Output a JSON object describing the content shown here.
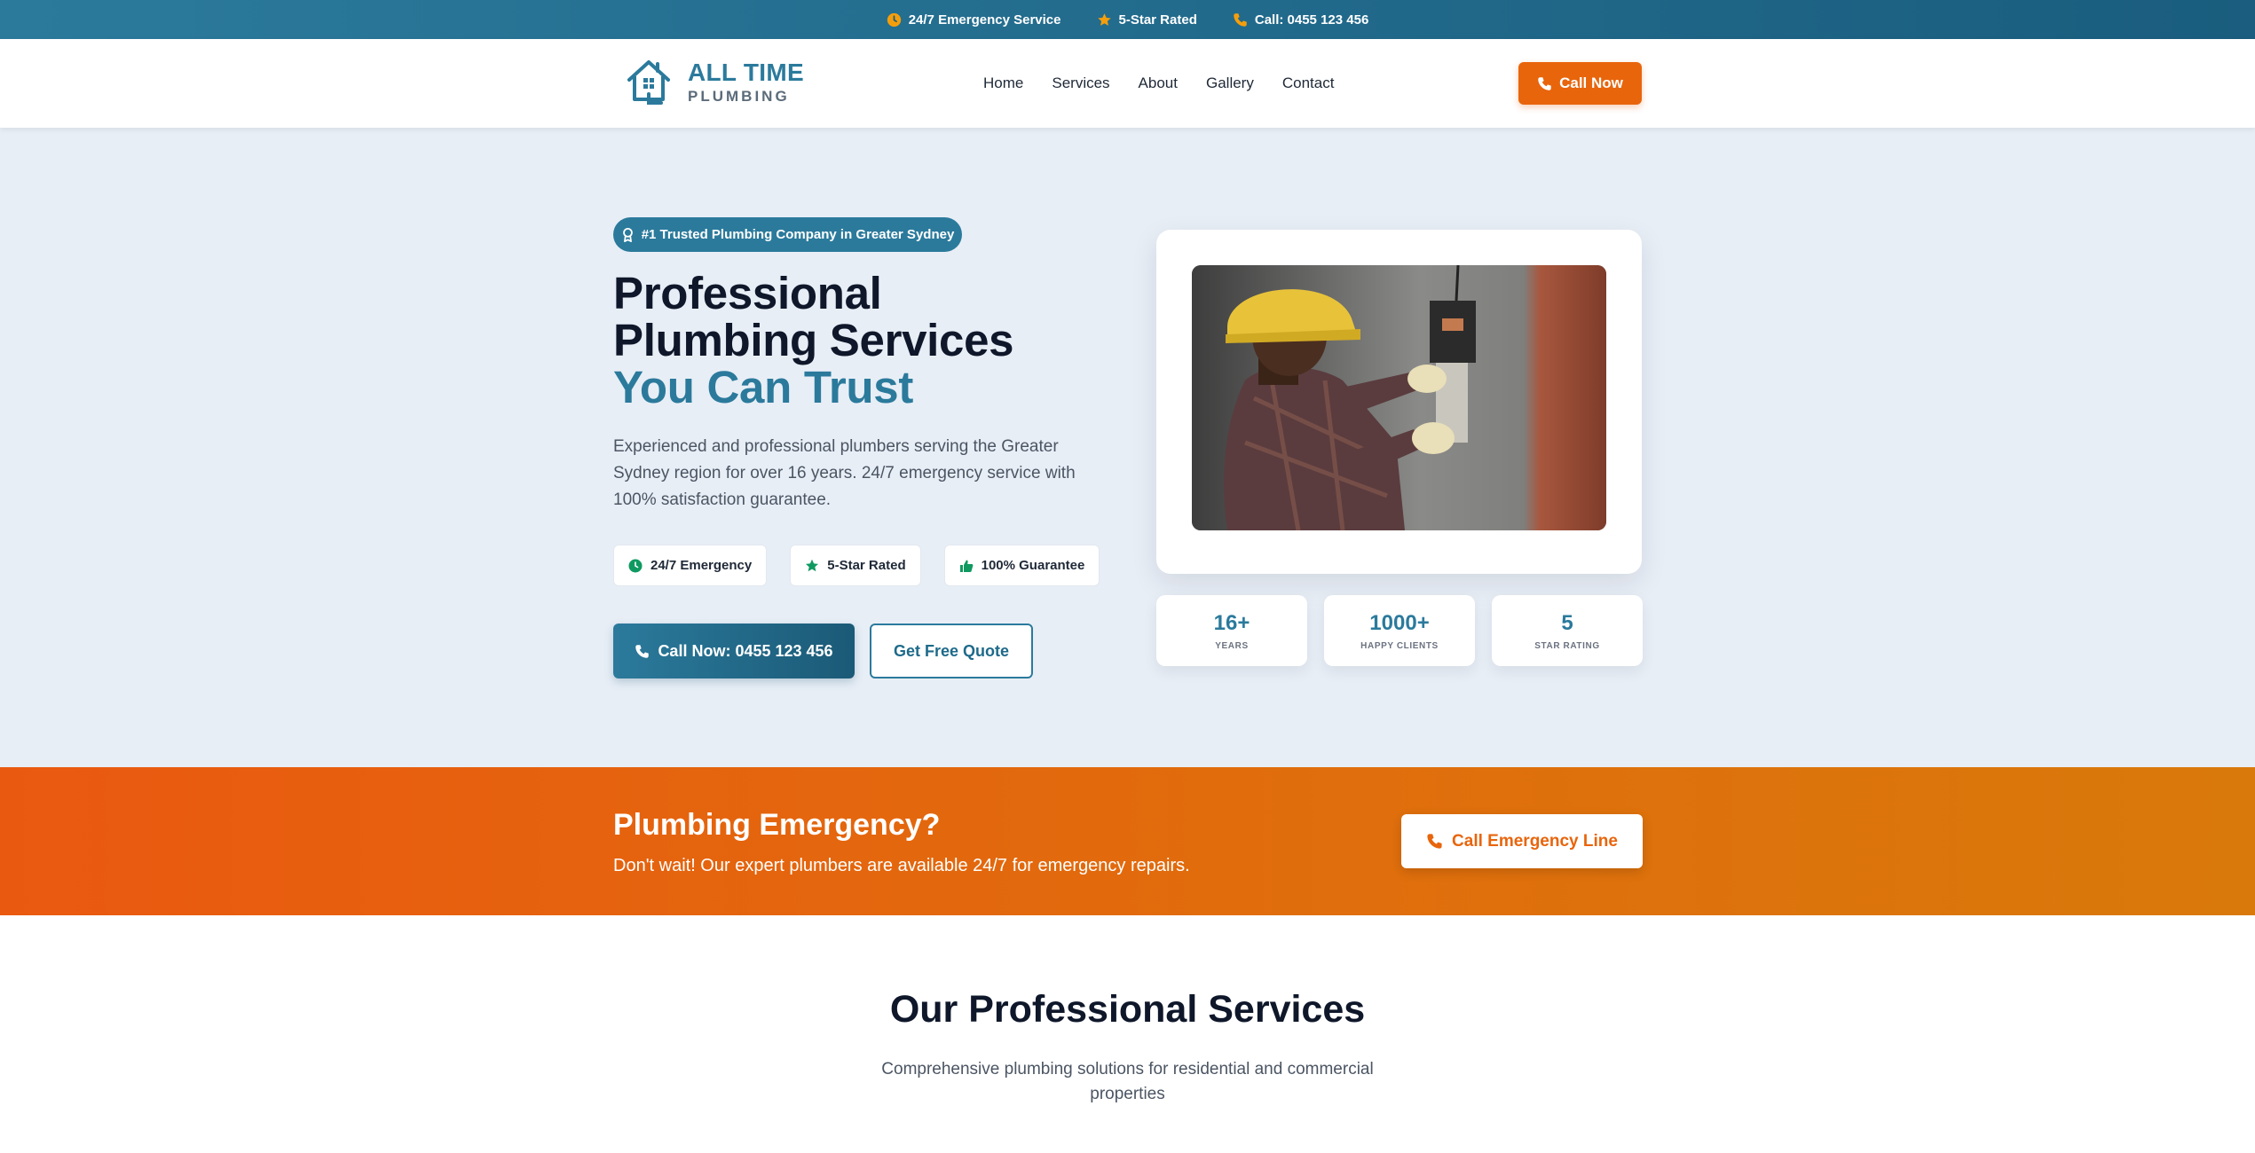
{
  "topbar": {
    "emergency": "24/7 Emergency Service",
    "rating": "5-Star Rated",
    "phone": "Call: 0455 123 456"
  },
  "brand": {
    "name": "ALL TIME",
    "sub": "PLUMBING"
  },
  "nav": {
    "items": [
      "Home",
      "Services",
      "About",
      "Gallery",
      "Contact"
    ],
    "cta": "Call Now"
  },
  "hero": {
    "badge": "#1 Trusted Plumbing Company in Greater Sydney",
    "title_line1": "Professional",
    "title_line2": "Plumbing Services",
    "title_accent": "You Can Trust",
    "description": "Experienced and professional plumbers serving the Greater Sydney region for over 16 years. 24/7 emergency service with 100% satisfaction guarantee.",
    "chips": [
      "24/7 Emergency",
      "5-Star Rated",
      "100% Guarantee"
    ],
    "primary_button": "Call Now: 0455 123 456",
    "secondary_button": "Get Free Quote"
  },
  "stats": [
    {
      "value": "16+",
      "label": "YEARS"
    },
    {
      "value": "1000+",
      "label": "HAPPY CLIENTS"
    },
    {
      "value": "5",
      "label": "STAR RATING"
    }
  ],
  "emergency": {
    "title": "Plumbing Emergency?",
    "description": "Don't wait! Our expert plumbers are available 24/7 for emergency repairs.",
    "button": "Call Emergency Line"
  },
  "services": {
    "title": "Our Professional Services",
    "subtitle": "Comprehensive plumbing solutions for residential and commercial properties"
  },
  "colors": {
    "brand_teal": "#2b7a9c",
    "accent_orange": "#e8650c",
    "green_check": "#0f9960",
    "star_orange": "#f59e0b",
    "hero_bg": "#e8eef6"
  },
  "icons": {
    "clock": "clock-icon",
    "star": "star-icon",
    "phone": "phone-icon",
    "logo": "house-logo-icon",
    "award": "award-icon",
    "thumbs": "thumbs-up-icon"
  }
}
